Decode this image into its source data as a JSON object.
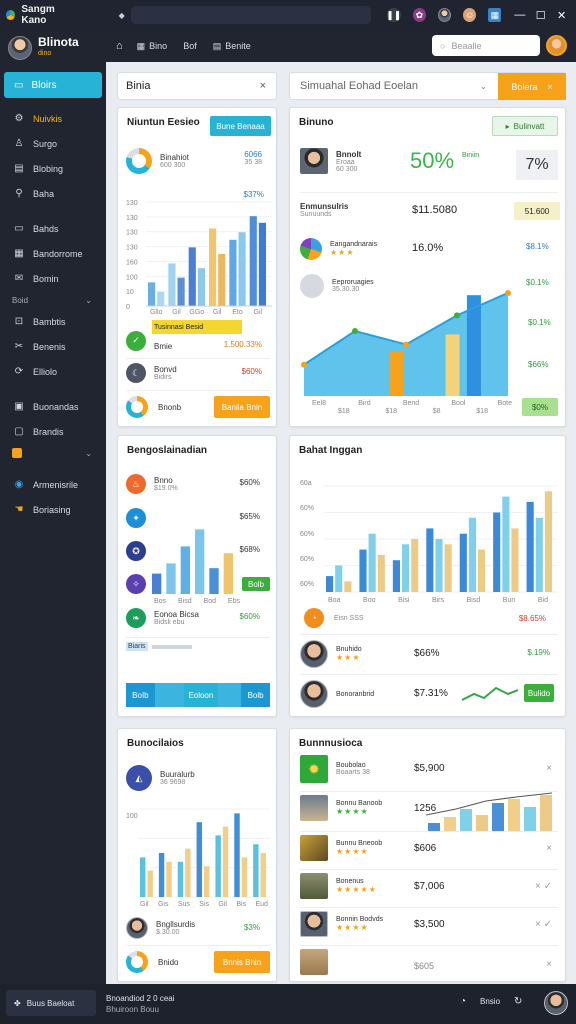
{
  "window": {
    "title": "Sangm Kano",
    "colors": {
      "chrome": "#1f2430",
      "sidebar": "#20252f",
      "accent": "#27b3d6",
      "orange": "#f7a21b",
      "green": "#2e9e3e"
    }
  },
  "sidebar": {
    "brand": "Blinota",
    "brand_sub": "dino",
    "active_item": "Bloirs",
    "items": [
      {
        "icon": "gear-icon",
        "glyph": "⚙",
        "label": "Nuivkis"
      },
      {
        "icon": "user-icon",
        "glyph": "♙",
        "label": "Surgo"
      },
      {
        "icon": "document-icon",
        "glyph": "▤",
        "label": "Blobing"
      },
      {
        "icon": "search-icon",
        "glyph": "⚲",
        "label": "Baha"
      }
    ],
    "items2": [
      {
        "icon": "folder-icon",
        "glyph": "▭",
        "label": "Bahds"
      },
      {
        "icon": "dashboard-icon",
        "glyph": "▦",
        "label": "Bandorrome"
      },
      {
        "icon": "mail-icon",
        "glyph": "✉",
        "label": "Bomin"
      }
    ],
    "section1": "Boid",
    "items3": [
      {
        "icon": "lock-icon",
        "glyph": "⊡",
        "label": "Bambtis"
      },
      {
        "icon": "tools-icon",
        "glyph": "✂",
        "label": "Benenis"
      },
      {
        "icon": "refresh-icon",
        "glyph": "⟳",
        "label": "Elliolo"
      }
    ],
    "items4": [
      {
        "icon": "calendar-icon",
        "glyph": "▣",
        "label": "Buonandas"
      },
      {
        "icon": "chat-icon",
        "glyph": "▢",
        "label": "Brandis"
      }
    ],
    "section2": "",
    "items5": [
      {
        "icon": "globe-icon",
        "glyph": "◉",
        "label": "Armenisrile"
      },
      {
        "icon": "hand-icon",
        "glyph": "☚",
        "label": "Boriasing"
      }
    ]
  },
  "header": {
    "tabs": [
      {
        "icon": "grid-icon",
        "label": "Bino"
      },
      {
        "icon": "list-icon",
        "label": "Bof"
      },
      {
        "icon": "book-icon",
        "label": "Benite"
      }
    ],
    "search_placeholder": "Beaalle"
  },
  "filter_bar": {
    "label": "Binia",
    "close": "×"
  },
  "dropdown_bar": {
    "value": "Simuahal Eohad Eoelan",
    "action_label": "Bolera",
    "action_close": "×"
  },
  "card1": {
    "title": "Niuntun Eesieo",
    "button": "Bune Benaaa",
    "donut_label": "Binahiot",
    "donut_sub": "600 300",
    "donut_value": "6066",
    "donut_value2": "35 38",
    "ylabel_value": "$37%",
    "yticks": [
      "130",
      "130",
      "130",
      "130",
      "160",
      "100",
      "10",
      "0"
    ],
    "xticks": [
      "Gllo",
      "Gil",
      "GGo",
      "Gil",
      "Eto",
      "Gil"
    ],
    "highlight": "Tusinnasi Besid",
    "row1_label": "Bmie",
    "row1_value": "1.500.33%",
    "row2_label": "Bonvd",
    "row2_sub": "Bidirs",
    "row2_value": "$60%",
    "footer_label": "Bnonb",
    "footer_button": "Baniia Bnin"
  },
  "card2": {
    "title": "Binuno",
    "button": "Bulinvatt",
    "person_name": "Bnnolt",
    "person_sub": "Eroaa",
    "person_sub2": "60 300",
    "big_value": "50%",
    "big_label": "Biniin",
    "badge_value": "7%",
    "row1_label": "Enmunsulris",
    "row1_sub": "Sunuunds",
    "row1_value": "$11.5080",
    "row1_badge": "51.600",
    "row2_label": "Eangandnarais",
    "row2_stars": "★★★",
    "row2_value": "16.0%",
    "row2_right": "$8.1%",
    "row3_label": "Eeproruagies",
    "row3_sub": "35.30.30",
    "row3_right": "$0.1%",
    "right_values": [
      "$0.1%",
      "$66%"
    ],
    "xticks": [
      "Eel8",
      "Bird",
      "Bend",
      "Bool",
      "Bote"
    ],
    "xticks2": [
      "$18",
      "$18",
      "$8",
      "$18"
    ],
    "footer_badge": "$0%"
  },
  "card3": {
    "title": "Bengoslainadian",
    "rows": [
      {
        "icon": "flame-icon",
        "label": "Bnno",
        "sub": "$19.0%",
        "value": "$60%"
      },
      {
        "icon": "twitter-icon",
        "label": "",
        "sub": "",
        "value": "$65%"
      },
      {
        "icon": "shield-icon",
        "label": "",
        "sub": "",
        "value": "$68%"
      },
      {
        "icon": "star-icon",
        "label": "",
        "sub": "",
        "value": ""
      },
      {
        "icon": "leaf-icon",
        "label": "Eonoa Bicsa",
        "sub": "Bidsli ebu",
        "value": "$60%"
      }
    ],
    "chart_badge": "Bolb",
    "row_bar_label": "Biaris",
    "footer_cells": [
      "BoIb",
      "",
      "Eoloon",
      "",
      "Bolb"
    ]
  },
  "card4": {
    "title": "Bahat Inggan",
    "yticks": [
      "60a",
      "60%",
      "60%",
      "60%",
      "60%"
    ],
    "xticks": [
      "Boa",
      "Boo",
      "Bisi",
      "Birs",
      "Bisd",
      "Bun",
      "Bid"
    ],
    "row1_sub": "Eisn SSS",
    "row1_right": "$8.65%",
    "person1_name": "Bnuhido",
    "person1_stars": "★★★",
    "person1_value": "$66%",
    "person1_right": "$.19%",
    "person2_name": "Bonoranbrid",
    "person2_value": "$7.31%",
    "person2_badge": "Bulido"
  },
  "card5": {
    "title": "Bunocilaios",
    "row_label": "Buuralurb",
    "row_sub": "36 9698",
    "ytick": "100",
    "xticks": [
      "Gil",
      "Gis",
      "Sus",
      "Sis",
      "Gil",
      "Bis",
      "Eud"
    ],
    "person_label": "Bngllsurdis",
    "person_sub": "$.30.00",
    "person_value": "$3%",
    "footer_label": "Bnido",
    "footer_button": "Bnnis Bhin"
  },
  "card6": {
    "title": "Bunnnusioca",
    "rows": [
      {
        "label": "Boubolao",
        "sub": "Boaarts 38",
        "value": "$5,900",
        "right": "×"
      },
      {
        "label": "Bonnu Banoob",
        "stars": "★★★★",
        "value": "1256",
        "right": ""
      },
      {
        "label": "Bunnu Bneoob",
        "stars": "★★★★",
        "value": "$606",
        "right": "×"
      },
      {
        "label": "Bonenus",
        "stars": "★★★★★",
        "value": "$7,006",
        "right": "× ✓"
      },
      {
        "label": "Bonnin Bodvds",
        "stars": "★★★★",
        "value": "$3,500",
        "right": "× ✓"
      },
      {
        "label": "",
        "stars": "",
        "value": "$605",
        "right": "×"
      }
    ]
  },
  "bottom": {
    "left_label": "Buus Baeloat",
    "center_line1": "Bnoandiod 2 0 ceai",
    "center_line2": "Bhuiroon Bouu",
    "right_label": "Bnsio"
  },
  "chart_data": [
    {
      "type": "bar",
      "categories": [
        "Gllo",
        "Gil",
        "GGo",
        "Gil",
        "Eto",
        "Gil"
      ],
      "series": [
        {
          "values": [
            25,
            45,
            62,
            82,
            70,
            95
          ]
        },
        {
          "values": [
            15,
            30,
            40,
            55,
            78,
            88
          ]
        }
      ],
      "ylim": [
        0,
        110
      ]
    },
    {
      "type": "area",
      "x": [
        "Eel8",
        "Bird",
        "Bend",
        "Bool",
        "Bote"
      ],
      "values": [
        28,
        58,
        46,
        72,
        92
      ],
      "bars": [
        40,
        55,
        90
      ],
      "ylim": [
        0,
        100
      ]
    },
    {
      "type": "bar",
      "categories": [
        "Bos",
        "Bisd",
        "Bod",
        "Ebs"
      ],
      "values": [
        30,
        45,
        70,
        95,
        38,
        60
      ],
      "ylim": [
        0,
        100
      ]
    },
    {
      "type": "bar",
      "categories": [
        "Boa",
        "Boo",
        "Bisi",
        "Birs",
        "Bisd",
        "Bun",
        "Bid"
      ],
      "series": [
        {
          "values": [
            15,
            40,
            30,
            60,
            55,
            75,
            85
          ]
        },
        {
          "values": [
            25,
            55,
            45,
            50,
            70,
            90,
            70
          ]
        },
        {
          "values": [
            10,
            35,
            50,
            45,
            40,
            60,
            95
          ]
        }
      ],
      "ylim": [
        0,
        100
      ]
    },
    {
      "type": "bar",
      "categories": [
        "Gil",
        "Gis",
        "Sus",
        "Sis",
        "Gil",
        "Bis",
        "Eud"
      ],
      "series": [
        {
          "values": [
            45,
            50,
            40,
            85,
            70,
            95,
            60
          ]
        },
        {
          "values": [
            30,
            40,
            55,
            35,
            80,
            45,
            50
          ]
        }
      ],
      "ylim": [
        0,
        100
      ]
    }
  ]
}
